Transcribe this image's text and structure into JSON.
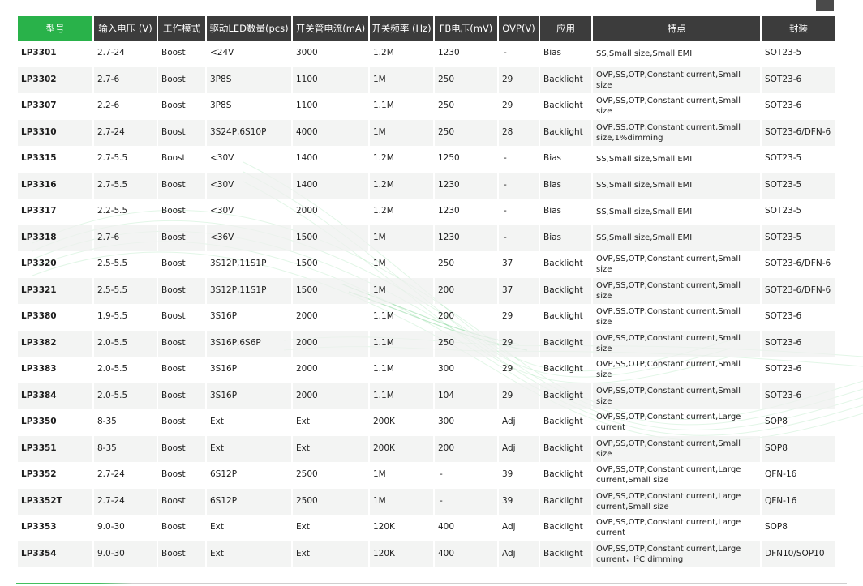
{
  "headers": [
    "型号",
    "输入电压 (V)",
    "工作模式",
    "驱动LED数量(pcs)",
    "开关管电流(mA)",
    "开关频率 (Hz)",
    "FB电压(mV)",
    "OVP(V)",
    "应用",
    "特点",
    "封装"
  ],
  "rows": [
    [
      "LP3301",
      "2.7-24",
      "Boost",
      "<24V",
      "3000",
      "1.2M",
      "1230",
      "-",
      "Bias",
      "SS,Small size,Small EMI",
      "SOT23-5"
    ],
    [
      "LP3302",
      "2.7-6",
      "Boost",
      "3P8S",
      "1100",
      "1M",
      "250",
      "29",
      "Backlight",
      "OVP,SS,OTP,Constant current,Small size",
      "SOT23-6"
    ],
    [
      "LP3307",
      "2.2-6",
      "Boost",
      "3P8S",
      "1100",
      "1.1M",
      "250",
      "29",
      "Backlight",
      "OVP,SS,OTP,Constant current,Small size",
      "SOT23-6"
    ],
    [
      "LP3310",
      "2.7-24",
      "Boost",
      "3S24P,6S10P",
      "4000",
      "1M",
      "250",
      "28",
      "Backlight",
      "OVP,SS,OTP,Constant current,Small size,1%dimming",
      "SOT23-6/DFN-6"
    ],
    [
      "LP3315",
      "2.7-5.5",
      "Boost",
      "<30V",
      "1400",
      "1.2M",
      "1250",
      "-",
      "Bias",
      "SS,Small size,Small EMI",
      "SOT23-5"
    ],
    [
      "LP3316",
      "2.7-5.5",
      "Boost",
      "<30V",
      "1400",
      "1.2M",
      "1230",
      "-",
      "Bias",
      "SS,Small size,Small EMI",
      "SOT23-5"
    ],
    [
      "LP3317",
      "2.2-5.5",
      "Boost",
      "<30V",
      "2000",
      "1.2M",
      "1230",
      "-",
      "Bias",
      "SS,Small size,Small EMI",
      "SOT23-5"
    ],
    [
      "LP3318",
      "2.7-6",
      "Boost",
      "<36V",
      "1500",
      "1M",
      "1230",
      "-",
      "Bias",
      "SS,Small size,Small EMI",
      "SOT23-5"
    ],
    [
      "LP3320",
      "2.5-5.5",
      "Boost",
      "3S12P,11S1P",
      "1500",
      "1M",
      "250",
      "37",
      "Backlight",
      "OVP,SS,OTP,Constant current,Small size",
      "SOT23-6/DFN-6"
    ],
    [
      "LP3321",
      "2.5-5.5",
      "Boost",
      "3S12P,11S1P",
      "1500",
      "1M",
      "200",
      "37",
      "Backlight",
      "OVP,SS,OTP,Constant current,Small size",
      "SOT23-6/DFN-6"
    ],
    [
      "LP3380",
      "1.9-5.5",
      "Boost",
      "3S16P",
      "2000",
      "1.1M",
      "200",
      "29",
      "Backlight",
      "OVP,SS,OTP,Constant current,Small size",
      "SOT23-6"
    ],
    [
      "LP3382",
      "2.0-5.5",
      "Boost",
      "3S16P,6S6P",
      "2000",
      "1.1M",
      "250",
      "29",
      "Backlight",
      "OVP,SS,OTP,Constant current,Small size",
      "SOT23-6"
    ],
    [
      "LP3383",
      "2.0-5.5",
      "Boost",
      "3S16P",
      "2000",
      "1.1M",
      "300",
      "29",
      "Backlight",
      "OVP,SS,OTP,Constant current,Small size",
      "SOT23-6"
    ],
    [
      "LP3384",
      "2.0-5.5",
      "Boost",
      "3S16P",
      "2000",
      "1.1M",
      "104",
      "29",
      "Backlight",
      "OVP,SS,OTP,Constant current,Small size",
      "SOT23-6"
    ],
    [
      "LP3350",
      "8-35",
      "Boost",
      "Ext",
      "Ext",
      "200K",
      "300",
      "Adj",
      "Backlight",
      "OVP,SS,OTP,Constant current,Large current",
      "SOP8"
    ],
    [
      "LP3351",
      "8-35",
      "Boost",
      "Ext",
      "Ext",
      "200K",
      "200",
      "Adj",
      "Backlight",
      "OVP,SS,OTP,Constant current,Small size",
      "SOP8"
    ],
    [
      "LP3352",
      "2.7-24",
      "Boost",
      "6S12P",
      "2500",
      "1M",
      "-",
      "39",
      "Backlight",
      "OVP,SS,OTP,Constant current,Large current,Small size",
      "QFN-16"
    ],
    [
      "LP3352T",
      "2.7-24",
      "Boost",
      "6S12P",
      "2500",
      "1M",
      "-",
      "39",
      "Backlight",
      "OVP,SS,OTP,Constant current,Large current,Small size",
      "QFN-16"
    ],
    [
      "LP3353",
      "9.0-30",
      "Boost",
      "Ext",
      "Ext",
      "120K",
      "400",
      "Adj",
      "Backlight",
      "OVP,SS,OTP,Constant current,Large current",
      "SOP8"
    ],
    [
      "LP3354",
      "9.0-30",
      "Boost",
      "Ext",
      "Ext",
      "120K",
      "400",
      "Adj",
      "Backlight",
      "OVP,SS,OTP,Constant current,Large current，I²C dimming",
      "DFN10/SOP10"
    ]
  ],
  "colors": {
    "header_accent": "#29b24a",
    "header_bg": "#3c3c3c",
    "stripe": "#eef0ee",
    "swirl": "#4cc46a"
  },
  "icons": {
    "corner": "menu-toggle-icon"
  }
}
